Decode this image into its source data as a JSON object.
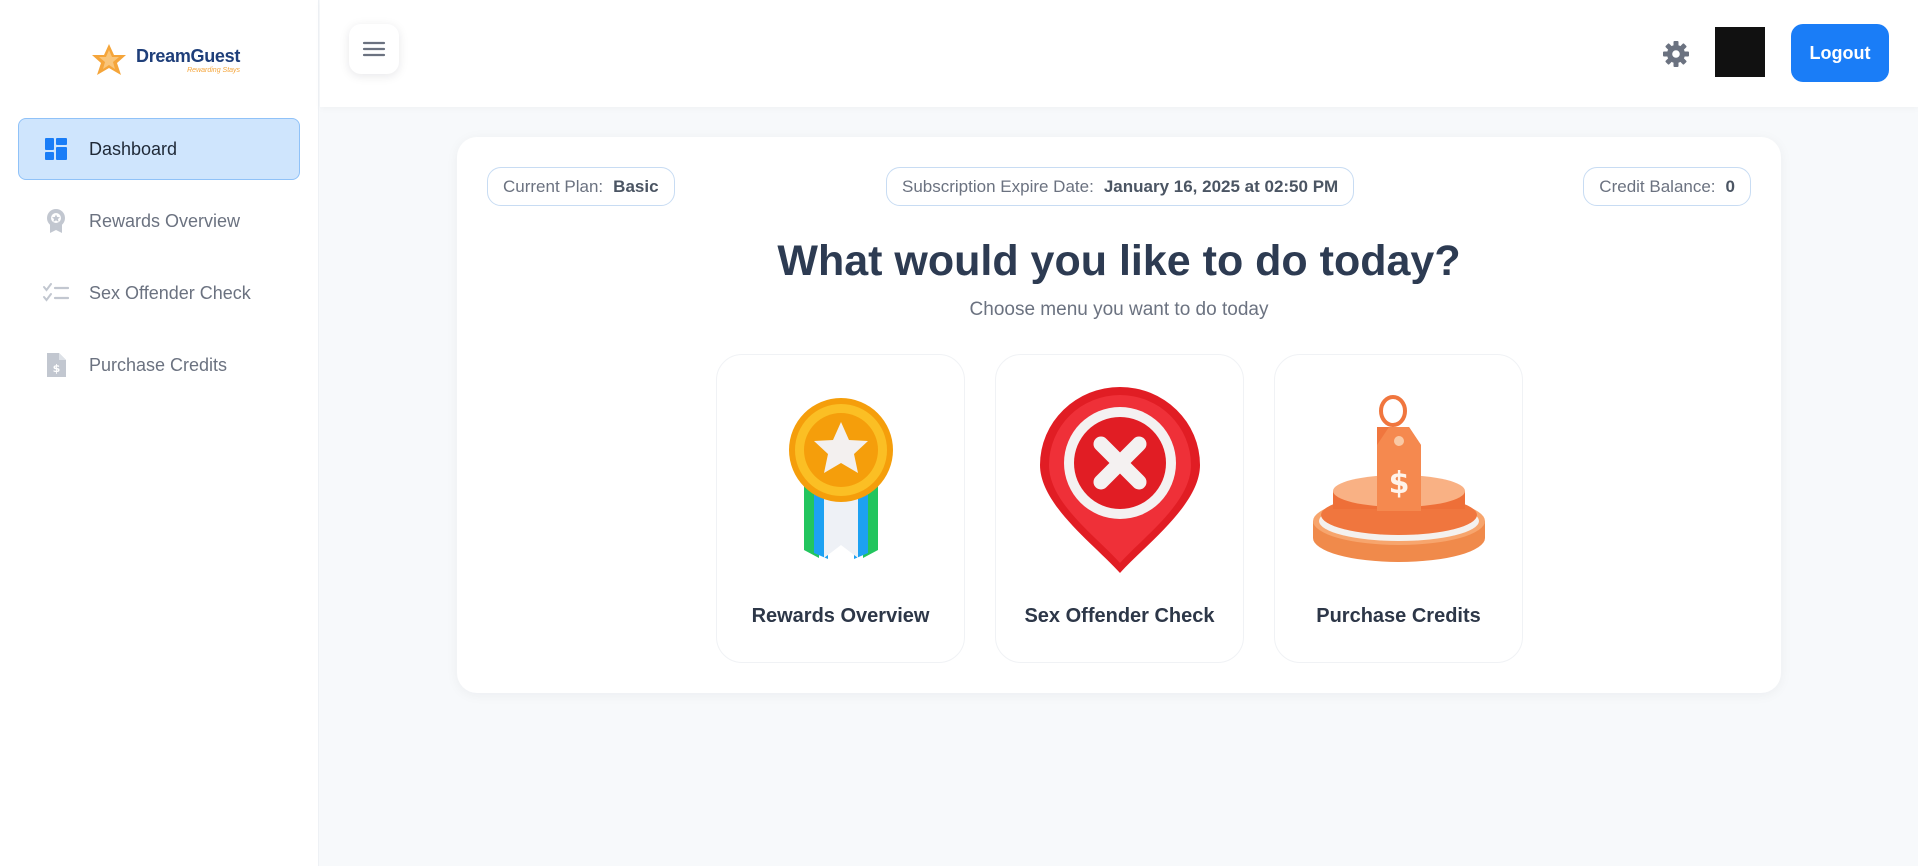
{
  "brand": {
    "name": "DreamGuest",
    "tagline": "Rewarding Stays"
  },
  "sidebar": {
    "items": [
      {
        "label": "Dashboard",
        "icon": "dashboard-icon",
        "active": true
      },
      {
        "label": "Rewards Overview",
        "icon": "award-icon",
        "active": false
      },
      {
        "label": "Sex Offender Check",
        "icon": "checklist-icon",
        "active": false
      },
      {
        "label": "Purchase Credits",
        "icon": "dollar-document-icon",
        "active": false
      }
    ]
  },
  "header": {
    "menu_icon": "hamburger-menu-icon",
    "settings_icon": "gear-icon",
    "logout_label": "Logout"
  },
  "plan": {
    "label": "Current Plan:",
    "value": "Basic"
  },
  "subscription": {
    "label": "Subscription Expire Date:",
    "value": "January 16, 2025 at 02:50 PM"
  },
  "credits": {
    "label": "Credit Balance:",
    "value": "0"
  },
  "main": {
    "title": "What would you like to do today?",
    "subtitle": "Choose menu you want to do today",
    "options": [
      {
        "label": "Rewards Overview",
        "icon": "medal-icon"
      },
      {
        "label": "Sex Offender Check",
        "icon": "x-location-pin-icon"
      },
      {
        "label": "Purchase Credits",
        "icon": "price-tag-icon"
      }
    ]
  },
  "colors": {
    "accent": "#1a7df7",
    "active_nav_bg": "#cfe5fd",
    "heading": "#2d3b52"
  }
}
